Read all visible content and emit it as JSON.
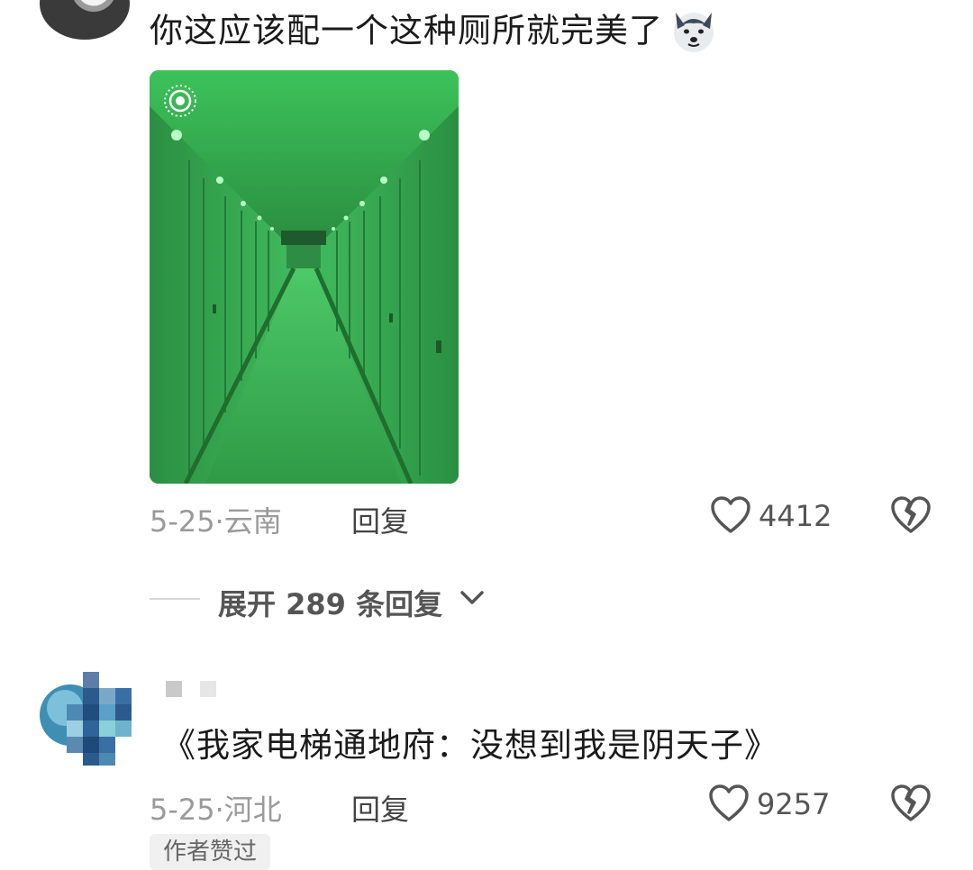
{
  "comments": [
    {
      "text": "你这应该配一个这种厕所就完美了",
      "emoji": "dog-emoji",
      "image": {
        "description_icon": "live-photo-icon",
        "colors": {
          "primary": "#3cab52",
          "light": "#7fe08a",
          "dark": "#1f6e2d"
        }
      },
      "date": "5-25",
      "location": "云南",
      "reply_label": "回复",
      "likes": "4412"
    },
    {
      "text": "《我家电梯通地府：没想到我是阴天子》",
      "date": "5-25",
      "location": "河北",
      "reply_label": "回复",
      "likes": "9257",
      "badge": "作者赞过"
    }
  ],
  "expand": {
    "label": "展开 289 条回复"
  },
  "separator": "·",
  "colors": {
    "meta_gray": "#9a9a9a",
    "text": "#1b1b1b",
    "icon": "#555555"
  }
}
